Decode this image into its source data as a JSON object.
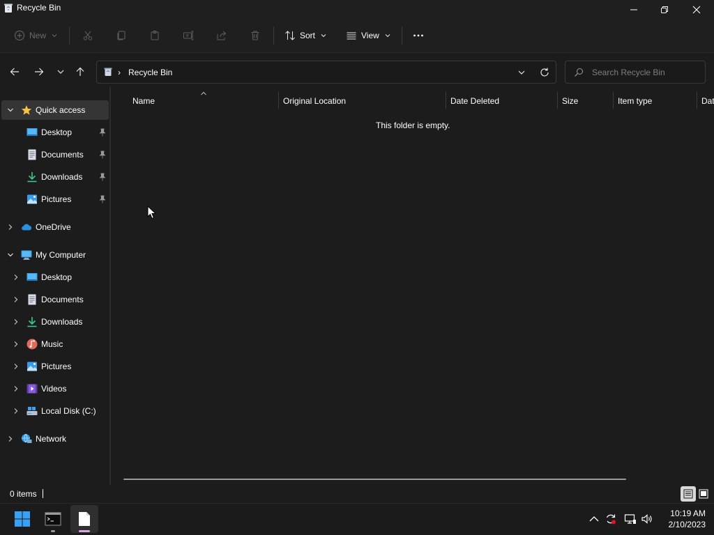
{
  "window": {
    "title": "Recycle Bin",
    "minimize_icon": "minimize-icon",
    "maximize_icon": "restore-icon",
    "close_icon": "close-icon"
  },
  "commandbar": {
    "new_label": "New",
    "sort_label": "Sort",
    "view_label": "View",
    "icons": [
      "cut-icon",
      "copy-icon",
      "paste-icon",
      "rename-icon",
      "share-icon",
      "delete-icon",
      "more-icon"
    ]
  },
  "address": {
    "path": "Recycle Bin",
    "separator": "›",
    "search_placeholder": "Search Recycle Bin"
  },
  "navpane": {
    "quick_access": {
      "label": "Quick access",
      "items": [
        {
          "label": "Desktop",
          "icon": "desktop-icon"
        },
        {
          "label": "Documents",
          "icon": "documents-icon"
        },
        {
          "label": "Downloads",
          "icon": "downloads-icon"
        },
        {
          "label": "Pictures",
          "icon": "pictures-icon"
        }
      ]
    },
    "onedrive": {
      "label": "OneDrive"
    },
    "computer": {
      "label": "My Computer",
      "items": [
        {
          "label": "Desktop",
          "icon": "desktop-icon"
        },
        {
          "label": "Documents",
          "icon": "documents-icon"
        },
        {
          "label": "Downloads",
          "icon": "downloads-icon"
        },
        {
          "label": "Music",
          "icon": "music-icon"
        },
        {
          "label": "Pictures",
          "icon": "pictures-icon"
        },
        {
          "label": "Videos",
          "icon": "videos-icon"
        },
        {
          "label": "Local Disk (C:)",
          "icon": "drive-icon"
        }
      ]
    },
    "network": {
      "label": "Network"
    }
  },
  "content": {
    "columns": [
      "Name",
      "Original Location",
      "Date Deleted",
      "Size",
      "Item type",
      "Dat"
    ],
    "empty_message": "This folder is empty."
  },
  "statusbar": {
    "item_count": "0 items"
  },
  "taskbar": {
    "time": "10:19 AM",
    "date": "2/10/2023"
  },
  "colors": {
    "background": "#1c1c1c",
    "selected": "#353535",
    "accent_folder": "#ffc83d",
    "windows_blue": "#3aa0f3"
  }
}
